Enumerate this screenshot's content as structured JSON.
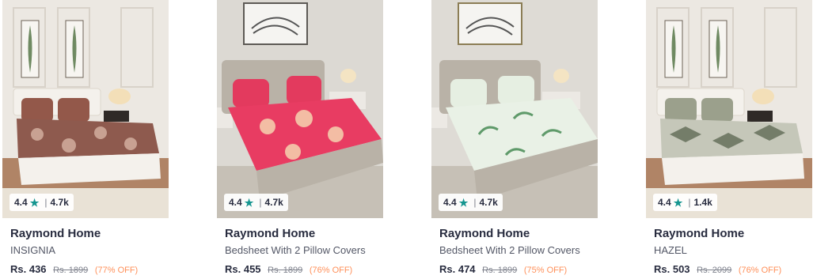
{
  "products": [
    {
      "rating": "4.4",
      "rating_count": "4.7k",
      "brand": "Raymond Home",
      "title": "INSIGNIA",
      "price": "Rs. 436",
      "mrp": "Rs. 1899",
      "discount": "(77% OFF)",
      "colors": {
        "wall": "#ece8e2",
        "sheet": "#8e5a4e",
        "pattern": "#d7b3a4",
        "pillow": "#93584a",
        "base": "#f4f1ec",
        "floor": "#b08466"
      }
    },
    {
      "rating": "4.4",
      "rating_count": "4.7k",
      "brand": "Raymond Home",
      "title": "Bedsheet With 2 Pillow Covers",
      "price": "Rs. 455",
      "mrp": "Rs. 1899",
      "discount": "(76% OFF)",
      "colors": {
        "wall": "#dcd9d3",
        "sheet": "#e83c62",
        "pattern": "#f4d3b0",
        "pillow": "#e33a5e",
        "base": "#b9b2a7",
        "floor": "#c6c0b6"
      }
    },
    {
      "rating": "4.4",
      "rating_count": "4.7k",
      "brand": "Raymond Home",
      "title": "Bedsheet With 2 Pillow Covers",
      "price": "Rs. 474",
      "mrp": "Rs. 1899",
      "discount": "(75% OFF)",
      "colors": {
        "wall": "#dedbd5",
        "sheet": "#e9f1e6",
        "pattern": "#5f9a6a",
        "pillow": "#e6efe2",
        "base": "#b9b2a7",
        "floor": "#c6c0b6"
      }
    },
    {
      "rating": "4.4",
      "rating_count": "1.4k",
      "brand": "Raymond Home",
      "title": "HAZEL",
      "price": "Rs. 503",
      "mrp": "Rs. 2099",
      "discount": "(76% OFF)",
      "colors": {
        "wall": "#ece8e2",
        "sheet": "#c5c7b9",
        "pattern": "#5f6a55",
        "pillow": "#9ba08c",
        "base": "#f4f1ec",
        "floor": "#b08466"
      }
    }
  ]
}
